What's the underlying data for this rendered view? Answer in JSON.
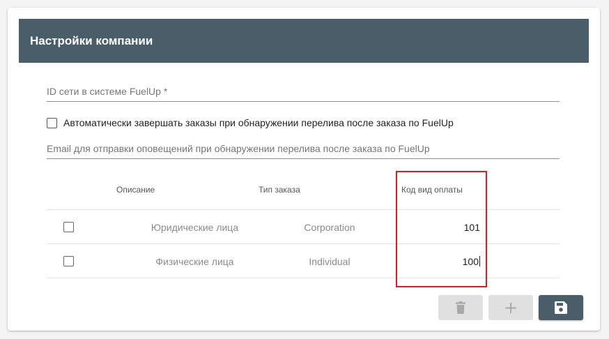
{
  "header": {
    "title": "Настройки компании"
  },
  "form": {
    "network_id": {
      "placeholder": "ID сети в системе FuelUp *",
      "value": ""
    },
    "auto_complete": {
      "label": "Автоматически завершать заказы при обнаружении перелива после заказа по FuelUp",
      "checked": false
    },
    "notify_email": {
      "placeholder": "Email для отправки оповещений при обнаружении перелива после заказа по FuelUp",
      "value": ""
    }
  },
  "table": {
    "columns": {
      "description": "Описание",
      "order_type": "Тип заказа",
      "payment_code": "Код вид оплаты"
    },
    "rows": [
      {
        "description": "Юридические лица",
        "order_type": "Corporation",
        "payment_code": "101",
        "checked": false
      },
      {
        "description": "Физические лица",
        "order_type": "Individual",
        "payment_code": "100",
        "checked": false
      }
    ]
  },
  "actions": {
    "delete_icon": "trash-icon",
    "add_icon": "plus-icon",
    "save_icon": "floppy-disk-icon"
  },
  "colors": {
    "header_bg": "#4a5e69",
    "highlight_border": "#e01b1b",
    "disabled_button": "#e0e0e0"
  }
}
